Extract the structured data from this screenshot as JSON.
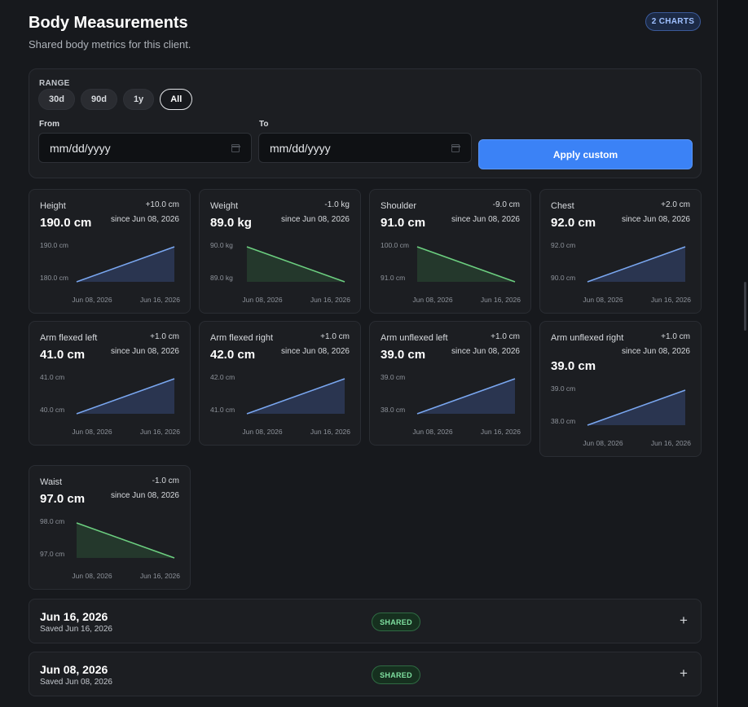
{
  "header": {
    "title": "Body Measurements",
    "subtitle": "Shared body metrics for this client.",
    "charts_badge": "2 CHARTS"
  },
  "filters": {
    "range_label": "RANGE",
    "ranges": [
      {
        "label": "30d",
        "active": false
      },
      {
        "label": "90d",
        "active": false
      },
      {
        "label": "1y",
        "active": false
      },
      {
        "label": "All",
        "active": true
      }
    ],
    "from_label": "From",
    "from_value": "mm/dd/yyyy",
    "to_label": "To",
    "to_value": "mm/dd/yyyy",
    "apply_label": "Apply custom"
  },
  "colors": {
    "up_line": "#7aa7f0",
    "up_fill": "#2a3550",
    "down_line": "#6ccf80",
    "down_fill": "#24382c",
    "accent": "#3b82f6"
  },
  "cards": [
    {
      "name": "Height",
      "value": "190.0 cm",
      "delta": "+10.0 cm",
      "since": "since Jun 08, 2026",
      "y_top_label": "190.0 cm",
      "y_bottom_label": "180.0 cm",
      "x_start_label": "Jun 08, 2026",
      "x_end_label": "Jun 16, 2026"
    },
    {
      "name": "Weight",
      "value": "89.0 kg",
      "delta": "-1.0 kg",
      "since": "since Jun 08, 2026",
      "y_top_label": "90.0 kg",
      "y_bottom_label": "89.0 kg",
      "x_start_label": "Jun 08, 2026",
      "x_end_label": "Jun 16, 2026"
    },
    {
      "name": "Shoulder",
      "value": "91.0 cm",
      "delta": "-9.0 cm",
      "since": "since Jun 08, 2026",
      "y_top_label": "100.0 cm",
      "y_bottom_label": "91.0 cm",
      "x_start_label": "Jun 08, 2026",
      "x_end_label": "Jun 16, 2026"
    },
    {
      "name": "Chest",
      "value": "92.0 cm",
      "delta": "+2.0 cm",
      "since": "since Jun 08, 2026",
      "y_top_label": "92.0 cm",
      "y_bottom_label": "90.0 cm",
      "x_start_label": "Jun 08, 2026",
      "x_end_label": "Jun 16, 2026"
    },
    {
      "name": "Arm flexed left",
      "value": "41.0 cm",
      "delta": "+1.0 cm",
      "since": "since Jun 08, 2026",
      "y_top_label": "41.0 cm",
      "y_bottom_label": "40.0 cm",
      "x_start_label": "Jun 08, 2026",
      "x_end_label": "Jun 16, 2026"
    },
    {
      "name": "Arm flexed right",
      "value": "42.0 cm",
      "delta": "+1.0 cm",
      "since": "since Jun 08, 2026",
      "y_top_label": "42.0 cm",
      "y_bottom_label": "41.0 cm",
      "x_start_label": "Jun 08, 2026",
      "x_end_label": "Jun 16, 2026"
    },
    {
      "name": "Arm unflexed left",
      "value": "39.0 cm",
      "delta": "+1.0 cm",
      "since": "since Jun 08, 2026",
      "y_top_label": "39.0 cm",
      "y_bottom_label": "38.0 cm",
      "x_start_label": "Jun 08, 2026",
      "x_end_label": "Jun 16, 2026"
    },
    {
      "name": "Arm unflexed right",
      "value": "39.0 cm",
      "delta": "+1.0 cm",
      "since": "since Jun 08, 2026",
      "y_top_label": "39.0 cm",
      "y_bottom_label": "38.0 cm",
      "x_start_label": "Jun 08, 2026",
      "x_end_label": "Jun 16, 2026"
    },
    {
      "name": "Waist",
      "value": "97.0 cm",
      "delta": "-1.0 cm",
      "since": "since Jun 08, 2026",
      "y_top_label": "98.0 cm",
      "y_bottom_label": "97.0 cm",
      "x_start_label": "Jun 08, 2026",
      "x_end_label": "Jun 16, 2026"
    }
  ],
  "chart_data": [
    {
      "type": "area",
      "title": "Height",
      "x": [
        "Jun 08, 2026",
        "Jun 16, 2026"
      ],
      "values": [
        180.0,
        190.0
      ],
      "unit": "cm",
      "ylim": [
        180.0,
        190.0
      ]
    },
    {
      "type": "area",
      "title": "Weight",
      "x": [
        "Jun 08, 2026",
        "Jun 16, 2026"
      ],
      "values": [
        90.0,
        89.0
      ],
      "unit": "kg",
      "ylim": [
        89.0,
        90.0
      ]
    },
    {
      "type": "area",
      "title": "Shoulder",
      "x": [
        "Jun 08, 2026",
        "Jun 16, 2026"
      ],
      "values": [
        100.0,
        91.0
      ],
      "unit": "cm",
      "ylim": [
        91.0,
        100.0
      ]
    },
    {
      "type": "area",
      "title": "Chest",
      "x": [
        "Jun 08, 2026",
        "Jun 16, 2026"
      ],
      "values": [
        90.0,
        92.0
      ],
      "unit": "cm",
      "ylim": [
        90.0,
        92.0
      ]
    },
    {
      "type": "area",
      "title": "Arm flexed left",
      "x": [
        "Jun 08, 2026",
        "Jun 16, 2026"
      ],
      "values": [
        40.0,
        41.0
      ],
      "unit": "cm",
      "ylim": [
        40.0,
        41.0
      ]
    },
    {
      "type": "area",
      "title": "Arm flexed right",
      "x": [
        "Jun 08, 2026",
        "Jun 16, 2026"
      ],
      "values": [
        41.0,
        42.0
      ],
      "unit": "cm",
      "ylim": [
        41.0,
        42.0
      ]
    },
    {
      "type": "area",
      "title": "Arm unflexed left",
      "x": [
        "Jun 08, 2026",
        "Jun 16, 2026"
      ],
      "values": [
        38.0,
        39.0
      ],
      "unit": "cm",
      "ylim": [
        38.0,
        39.0
      ]
    },
    {
      "type": "area",
      "title": "Arm unflexed right",
      "x": [
        "Jun 08, 2026",
        "Jun 16, 2026"
      ],
      "values": [
        38.0,
        39.0
      ],
      "unit": "cm",
      "ylim": [
        38.0,
        39.0
      ]
    },
    {
      "type": "area",
      "title": "Waist",
      "x": [
        "Jun 08, 2026",
        "Jun 16, 2026"
      ],
      "values": [
        98.0,
        97.0
      ],
      "unit": "cm",
      "ylim": [
        97.0,
        98.0
      ]
    }
  ],
  "entries": [
    {
      "date": "Jun 16, 2026",
      "saved": "Saved Jun 16, 2026",
      "badge": "SHARED",
      "toggle": "+"
    },
    {
      "date": "Jun 08, 2026",
      "saved": "Saved Jun 08, 2026",
      "badge": "SHARED",
      "toggle": "+"
    }
  ]
}
